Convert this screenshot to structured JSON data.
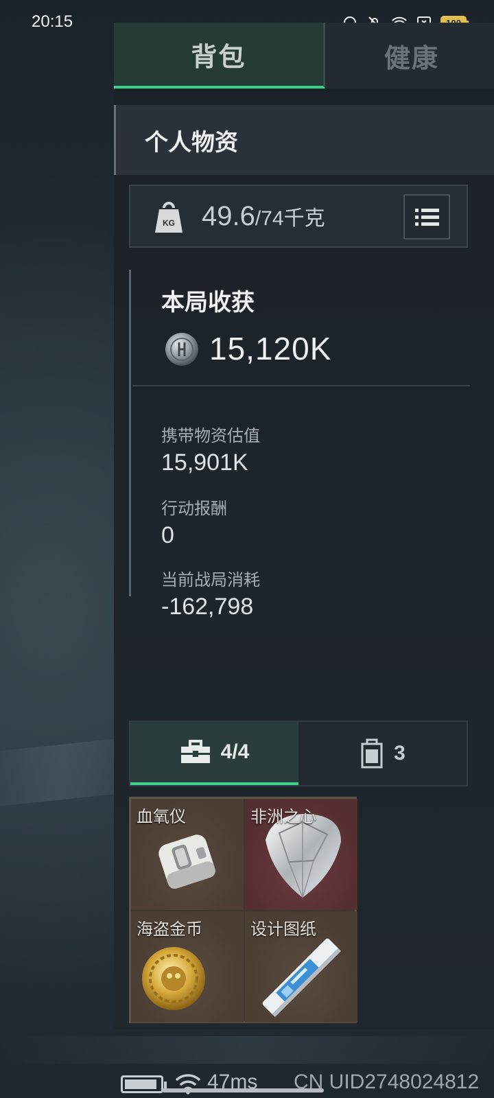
{
  "status_bar": {
    "time": "20:15",
    "battery": "100",
    "icons": [
      "headset-icon",
      "mute-bell-icon",
      "wifi-icon",
      "sim-x-icon",
      "battery-icon"
    ]
  },
  "tabs": [
    {
      "label": "背包",
      "selected": true
    },
    {
      "label": "健康",
      "selected": false
    }
  ],
  "section_title": "个人物资",
  "weight": {
    "current": "49.6",
    "max": "/74千克",
    "icon": "kg-weight-icon"
  },
  "harvest": {
    "title": "本局收获",
    "value": "15,120K",
    "coin_icon": "coin-icon",
    "stats": [
      {
        "label": "携带物资估值",
        "value": "15,901K"
      },
      {
        "label": "行动报酬",
        "value": "0"
      },
      {
        "label": "当前战局消耗",
        "value": "-162,798"
      }
    ]
  },
  "sub_tabs": [
    {
      "icon": "toolbox-icon",
      "label": "4/4",
      "selected": true
    },
    {
      "icon": "backpack-icon",
      "label": "3",
      "selected": false
    }
  ],
  "items": [
    {
      "label": "血氧仪",
      "icon": "oximeter-icon",
      "rarity_color": "#4a3e35"
    },
    {
      "label": "非洲之心",
      "icon": "diamond-icon",
      "rarity_color": "#552e32"
    },
    {
      "label": "海盗金币",
      "icon": "gold-coin-icon",
      "rarity_color": "#4a3e35"
    },
    {
      "label": "设计图纸",
      "icon": "blueprint-icon",
      "rarity_color": "#4a3e35"
    }
  ],
  "footer": {
    "ping": "47ms",
    "uid": "CN UID2748024812"
  },
  "colors": {
    "accent": "#3ccf8e",
    "battery": "#e0c04a"
  }
}
